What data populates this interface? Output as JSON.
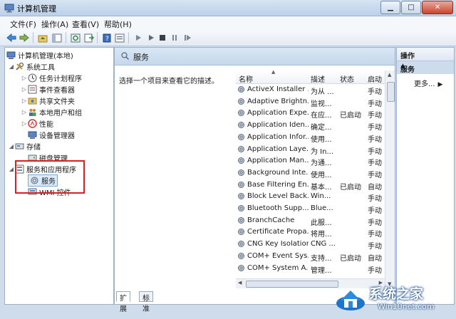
{
  "window": {
    "title": "计算机管理"
  },
  "menu": [
    "文件(F)",
    "操作(A)",
    "查看(V)",
    "帮助(H)"
  ],
  "tree": {
    "root": "计算机管理(本地)",
    "system_tools": "系统工具",
    "task_scheduler": "任务计划程序",
    "event_viewer": "事件查看器",
    "shared_folders": "共享文件夹",
    "local_users": "本地用户和组",
    "performance": "性能",
    "device_manager": "设备管理器",
    "storage": "存储",
    "disk_management": "磁盘管理",
    "services_apps": "服务和应用程序",
    "services": "服务",
    "wmi": "WMI 控件"
  },
  "center": {
    "header": "服务",
    "description": "选择一个项目来查看它的描述。",
    "columns": [
      "名称",
      "描述",
      "状态",
      "启动"
    ],
    "rows": [
      [
        "ActiveX Installer ...",
        "为从 ...",
        "",
        "手动"
      ],
      [
        "Adaptive Brightn...",
        "监视...",
        "",
        "手动"
      ],
      [
        "Application Expe...",
        "在应...",
        "已启动",
        "手动"
      ],
      [
        "Application Iden...",
        "确定...",
        "",
        "手动"
      ],
      [
        "Application Infor...",
        "使用...",
        "",
        "手动"
      ],
      [
        "Application Laye...",
        "为 In...",
        "",
        "手动"
      ],
      [
        "Application Man...",
        "为通...",
        "",
        "手动"
      ],
      [
        "Background Inte...",
        "使用...",
        "",
        "手动"
      ],
      [
        "Base Filtering En...",
        "基本...",
        "已启动",
        "自动"
      ],
      [
        "Block Level Back...",
        "Win...",
        "",
        "手动"
      ],
      [
        "Bluetooth Supp...",
        "Blue...",
        "",
        "手动"
      ],
      [
        "BranchCache",
        "此服...",
        "",
        "手动"
      ],
      [
        "Certificate Propa...",
        "将用...",
        "",
        "手动"
      ],
      [
        "CNG Key Isolation",
        "CNG ...",
        "",
        "手动"
      ],
      [
        "COM+ Event Sys...",
        "支持...",
        "已启动",
        "自动"
      ],
      [
        "COM+ System A...",
        "管理...",
        "",
        "手动"
      ]
    ],
    "tabs": [
      "扩展",
      "标准"
    ]
  },
  "actions": {
    "title": "操作",
    "section": "服务",
    "more": "更多..."
  },
  "watermark": {
    "main": "系统之家",
    "sub": "Win10net.com"
  }
}
